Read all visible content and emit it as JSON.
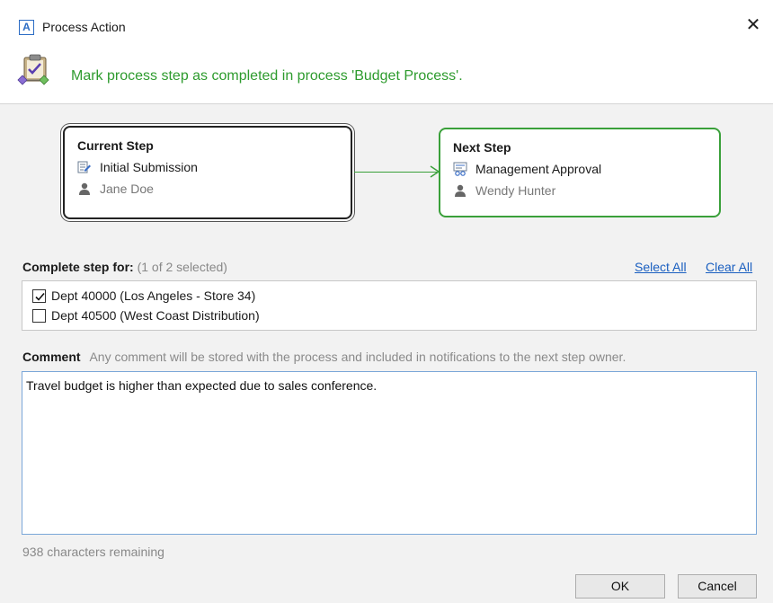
{
  "window": {
    "title": "Process Action",
    "app_icon_letter": "A",
    "close_glyph": "✕"
  },
  "header": {
    "message": "Mark process step as completed in process 'Budget Process'.",
    "icon": "process-clipboard-icon",
    "message_color": "#2e9b2e"
  },
  "current_step": {
    "title": "Current Step",
    "step_name": "Initial Submission",
    "owner": "Jane Doe"
  },
  "next_step": {
    "title": "Next Step",
    "step_name": "Management Approval",
    "owner": "Wendy Hunter",
    "border_color": "#3aa03a"
  },
  "complete_for": {
    "label": "Complete step for:",
    "selection_status": "(1 of 2 selected)",
    "select_all": "Select All",
    "clear_all": "Clear All",
    "items": [
      {
        "label": "Dept 40000 (Los Angeles - Store 34)",
        "checked": true
      },
      {
        "label": "Dept 40500 (West Coast Distribution)",
        "checked": false
      }
    ]
  },
  "comment": {
    "label": "Comment",
    "hint": "Any comment will be stored with the process and included in notifications to the next step owner.",
    "value": "Travel budget is higher than expected due to sales conference.",
    "remaining": "938 characters remaining"
  },
  "buttons": {
    "ok": "OK",
    "cancel": "Cancel"
  }
}
